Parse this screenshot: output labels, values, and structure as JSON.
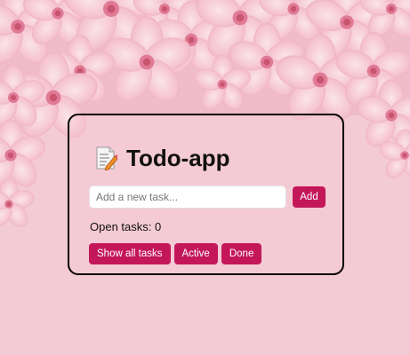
{
  "app": {
    "title": "Todo-app",
    "icon": "memo-icon"
  },
  "input": {
    "placeholder": "Add a new task...",
    "value": ""
  },
  "buttons": {
    "add_label": "Add"
  },
  "status": {
    "open_tasks_text": "Open tasks: 0"
  },
  "filters": [
    {
      "label": "Show all tasks"
    },
    {
      "label": "Active"
    },
    {
      "label": "Done"
    }
  ],
  "colors": {
    "accent": "#c4175a",
    "background": "#f4cdd7",
    "card_border": "#000000"
  }
}
